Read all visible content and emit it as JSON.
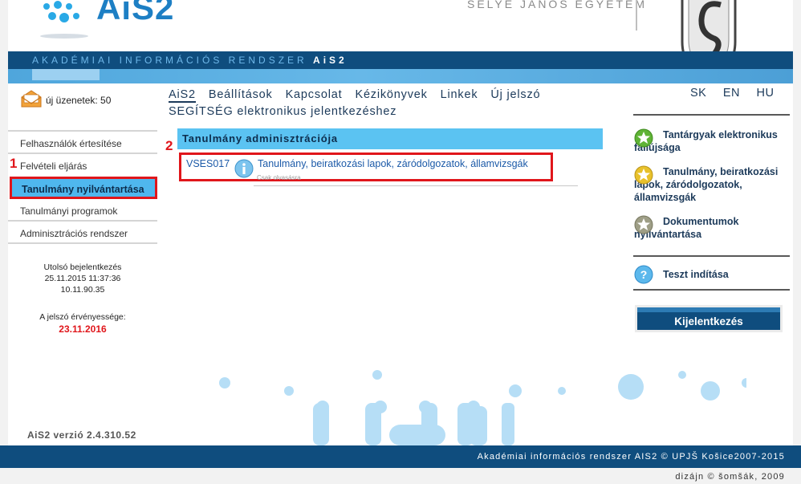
{
  "header": {
    "logo_text": "AiS2",
    "university": "SELYE JÁNOS EGYETEM",
    "brand_prefix": "AKADÉMIAI INFORMÁCIÓS RENDSZER",
    "brand_suffix": "AiS2"
  },
  "messages": {
    "icon": "envelope-icon",
    "text": "új üzenetek: 50"
  },
  "left_menu": {
    "items": [
      {
        "label": "Felhasználók értesítése"
      },
      {
        "label": "Felvételi eljárás"
      },
      {
        "label": "Tanulmány nyilvántartása",
        "active": true
      },
      {
        "label": "Tanulmányi programok"
      },
      {
        "label": "Adminisztrációs rendszer"
      }
    ]
  },
  "session": {
    "last_login_label": "Utolsó bejelentkezés",
    "last_login_time": "25.11.2015 11:37:36",
    "last_login_ip": "10.11.90.35",
    "pw_valid_label": "A jelszó érvényessége:",
    "pw_valid_date": "23.11.2016"
  },
  "annotations": {
    "one": "1",
    "two": "2"
  },
  "version": "AiS2 verzió 2.4.310.52",
  "top_nav": {
    "items": [
      "AiS2",
      "Beállítások",
      "Kapcsolat",
      "Kézikönyvek",
      "Linkek",
      "Új jelszó"
    ],
    "help": "SEGÍTSÉG elektronikus jelentkezéshez",
    "languages": "SK EN HU"
  },
  "main": {
    "panel_title": "Tanulmány adminisztrációja",
    "app_code": "VSES017",
    "app_name": "Tanulmány, beiratkozási lapok, záródolgozatok, államvizsgák",
    "app_sub": "Csak olvasásra"
  },
  "right": {
    "links": [
      {
        "icon": "green-star-icon",
        "label": "Tantárgyak elektronikus faliújsága"
      },
      {
        "icon": "yellow-star-icon",
        "label": "Tanulmány, beiratkozási lapok, záródolgozatok, államvizsgák"
      },
      {
        "icon": "gray-star-icon",
        "label": "Dokumentumok nyilvántartása"
      },
      {
        "icon": "help-icon",
        "label": "Teszt indítása"
      }
    ],
    "logout": "Kijelentkezés"
  },
  "footer": {
    "text": "Akadémiai információs rendszer AIS2 © UPJŠ Košice2007-2015",
    "design": "dizájn © šomšák, 2009"
  },
  "colors": {
    "navy": "#0f4d7e",
    "accent": "#4fb7ee",
    "highlight": "#e0161b"
  }
}
